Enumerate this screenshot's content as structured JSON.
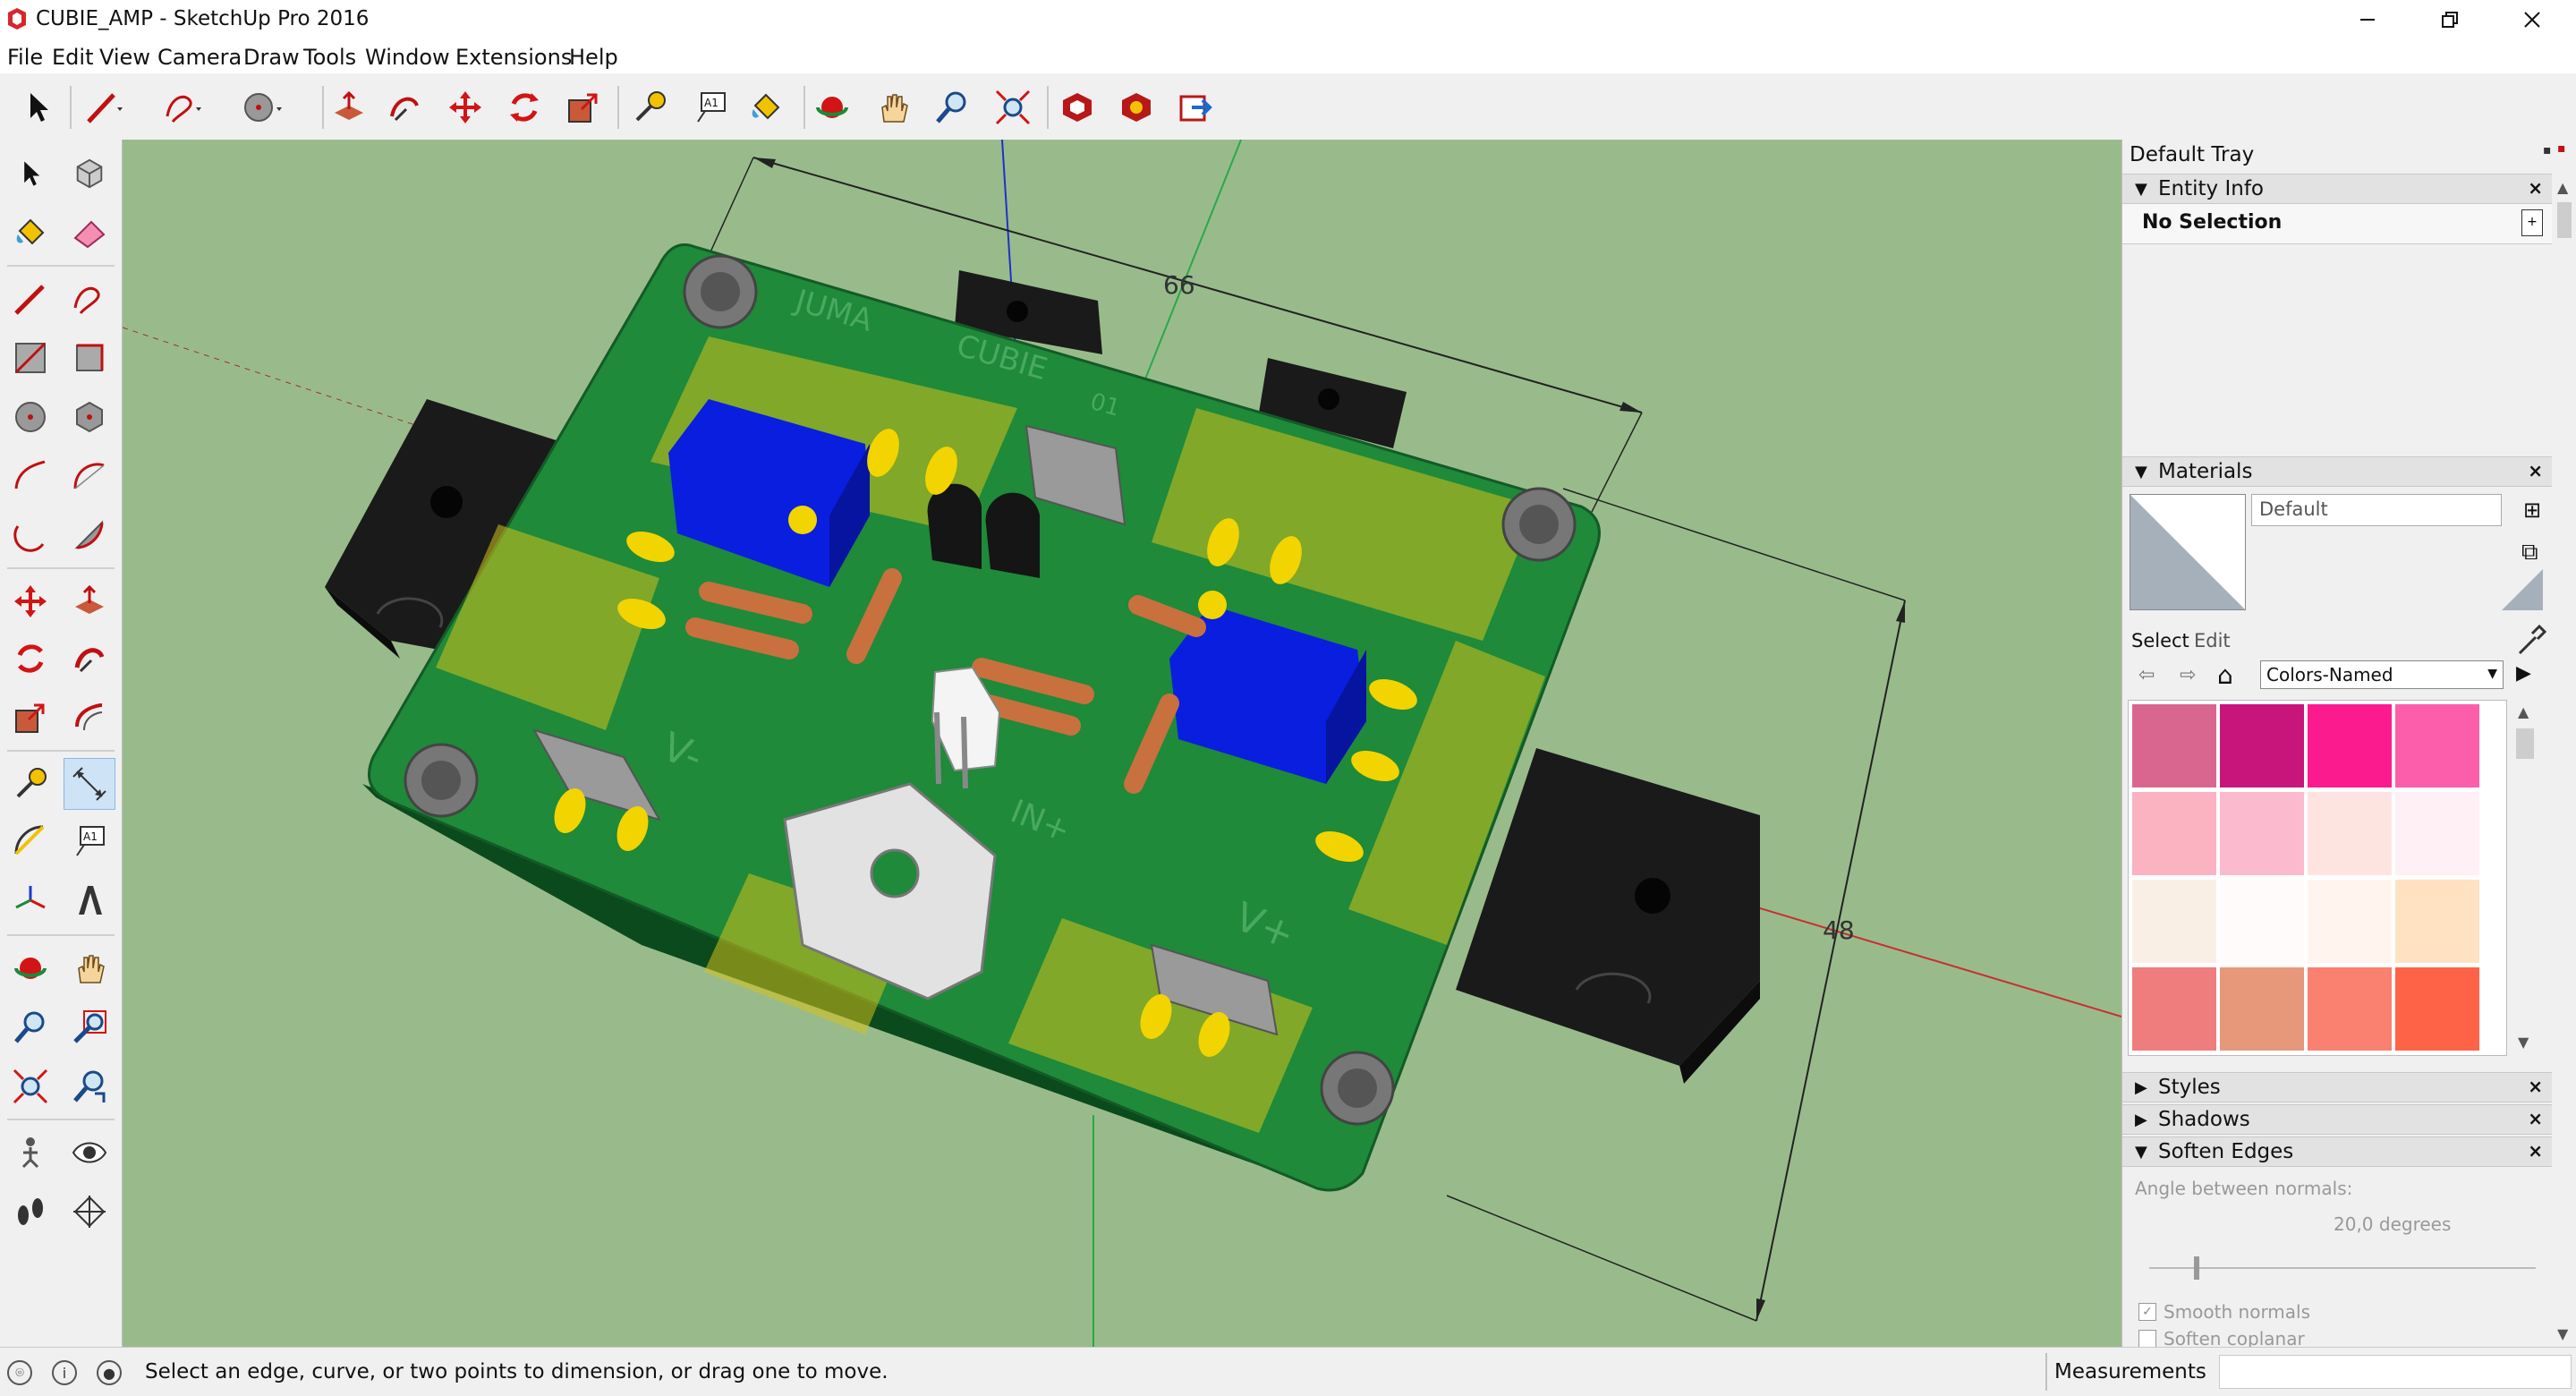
{
  "window": {
    "title": "CUBIE_AMP - SketchUp Pro 2016",
    "controls": {
      "minimize": "—",
      "restore": "❐",
      "close": "✕"
    }
  },
  "menu": [
    "File",
    "Edit",
    "View",
    "Camera",
    "Draw",
    "Tools",
    "Window",
    "Extensions",
    "Help"
  ],
  "toolbar": {
    "icons": [
      "select-icon",
      "pencil-icon",
      "freehand-icon",
      "circle-icon",
      "push-pull-icon",
      "follow-me-icon",
      "move-icon",
      "rotate-icon",
      "scale-icon",
      "tape-measure-icon",
      "text-icon",
      "paint-bucket-icon",
      "orbit-icon",
      "pan-icon",
      "zoom-icon",
      "zoom-extents-icon",
      "warehouse-icon",
      "extension-warehouse-icon",
      "send-to-layout-icon"
    ]
  },
  "model": {
    "dimensions": {
      "width_label": "66",
      "height_label": "48"
    },
    "board_text": {
      "brand": "JUMA",
      "name": "CUBIE",
      "number": "01",
      "vminus": "V-",
      "vplus": "V+",
      "vin": "IN+"
    }
  },
  "tray": {
    "title": "Default Tray",
    "entity_info": {
      "header": "Entity Info",
      "selection": "No Selection"
    },
    "materials": {
      "header": "Materials",
      "current_name": "Default",
      "tabs": {
        "select": "Select",
        "edit": "Edit"
      },
      "library": "Colors-Named",
      "swatches": [
        "#d9668e",
        "#c8157c",
        "#fc1b8f",
        "#fc5eac",
        "#fbb3c2",
        "#fbbacd",
        "#fee4e1",
        "#fff0f5",
        "#faefe5",
        "#fefbfa",
        "#fff5ee",
        "#ffe2c1",
        "#ef7d7e",
        "#e7977a",
        "#fa8070",
        "#fe6347"
      ]
    },
    "styles": {
      "header": "Styles"
    },
    "shadows": {
      "header": "Shadows"
    },
    "soften_edges": {
      "header": "Soften Edges",
      "angle_label": "Angle between normals:",
      "angle_value": "20,0  degrees",
      "smooth_label": "Smooth normals",
      "smooth_checked": true,
      "coplanar_label": "Soften coplanar",
      "coplanar_checked": false
    }
  },
  "status": {
    "message": "Select an edge, curve, or two points to dimension, or drag one to move.",
    "measurements_label": "Measurements"
  },
  "colors": {
    "viewport_bg": "#99bb8c",
    "pcb_green": "#1e8a3a",
    "pad_yellow": "#f2d400",
    "trimmer_blue": "#0a1ee0",
    "resistor_tan": "#c8703e",
    "bracket_black": "#1e1e1e"
  }
}
